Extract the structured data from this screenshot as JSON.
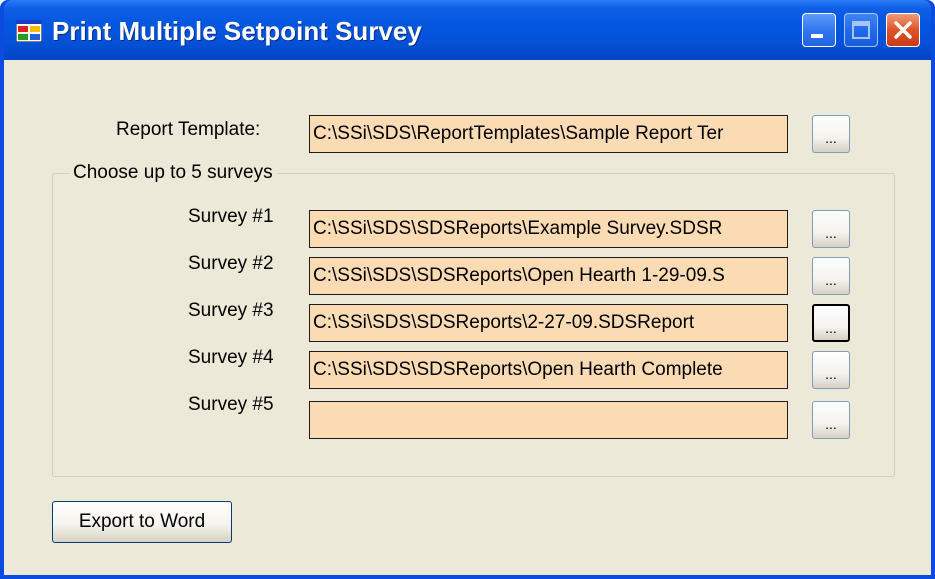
{
  "window": {
    "title": "Print Multiple Setpoint Survey",
    "title_icon": "app-window-icon"
  },
  "report_template": {
    "label": "Report Template:",
    "value": "C:\\SSi\\SDS\\ReportTemplates\\Sample Report Ter",
    "browse_label": "..."
  },
  "group": {
    "legend": "Choose up to 5 surveys",
    "surveys": [
      {
        "label": "Survey #1",
        "value": "C:\\SSi\\SDS\\SDSReports\\Example Survey.SDSR",
        "browse_label": "..."
      },
      {
        "label": "Survey #2",
        "value": "C:\\SSi\\SDS\\SDSReports\\Open Hearth 1-29-09.S",
        "browse_label": "..."
      },
      {
        "label": "Survey #3",
        "value": "C:\\SSi\\SDS\\SDSReports\\2-27-09.SDSReport",
        "browse_label": "..."
      },
      {
        "label": "Survey #4",
        "value": "C:\\SSi\\SDS\\SDSReports\\Open Hearth Complete",
        "browse_label": "..."
      },
      {
        "label": "Survey #5",
        "value": "",
        "browse_label": "..."
      }
    ]
  },
  "actions": {
    "export_label": "Export to Word"
  },
  "colors": {
    "field_background": "#fbdbb3",
    "dialog_background": "#ece9d8",
    "titlebar": "#0551d8",
    "close_button": "#e0542a"
  }
}
